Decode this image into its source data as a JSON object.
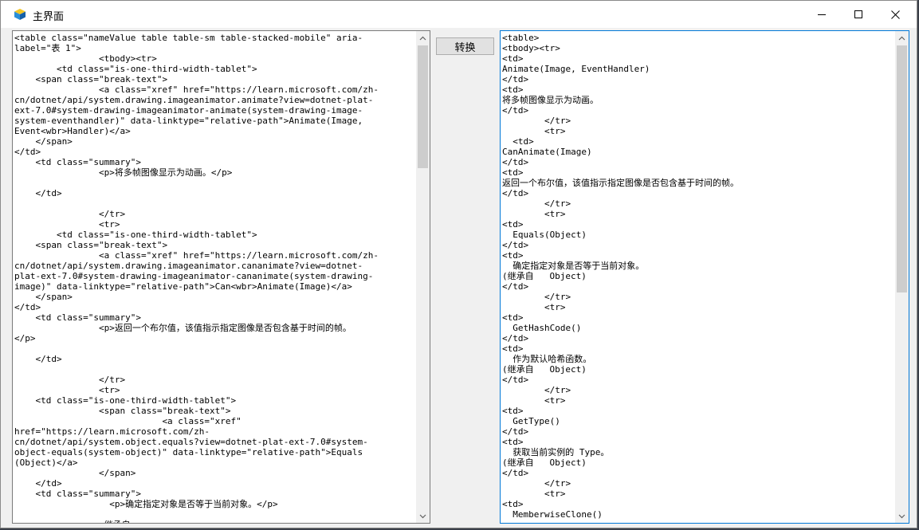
{
  "window": {
    "title": "主界面"
  },
  "toolbar": {
    "convert_label": "转换"
  },
  "left_editor": {
    "content": "<table class=\"nameValue table table-sm table-stacked-mobile\" aria-\nlabel=\"表 1\">\n\t\t\t\t<tbody><tr>\n\t\t<td class=\"is-one-third-width-tablet\">\n\t<span class=\"break-text\">\n\t\t\t\t<a class=\"xref\" href=\"https://learn.microsoft.com/zh-\ncn/dotnet/api/system.drawing.imageanimator.animate?view=dotnet-plat-\next-7.0#system-drawing-imageanimator-animate(system-drawing-image-\nsystem-eventhandler)\" data-linktype=\"relative-path\">Animate(Image,\nEvent<wbr>Handler)</a>\n\t</span>\n</td>\n\t<td class=\"summary\">\n\t\t\t\t<p>将多帧图像显示为动画。</p>\n\n\t</td>\n\n\t\t\t\t</tr>\n\t\t\t\t<tr>\n\t\t<td class=\"is-one-third-width-tablet\">\n\t<span class=\"break-text\">\n\t\t\t\t<a class=\"xref\" href=\"https://learn.microsoft.com/zh-\ncn/dotnet/api/system.drawing.imageanimator.cananimate?view=dotnet-\nplat-ext-7.0#system-drawing-imageanimator-cananimate(system-drawing-\nimage)\" data-linktype=\"relative-path\">Can<wbr>Animate(Image)</a>\n\t</span>\n</td>\n\t<td class=\"summary\">\n\t\t\t\t<p>返回一个布尔值，该值指示指定图像是否包含基于时间的帧。\n</p>\n\n\t</td>\n\n\t\t\t\t</tr>\n\t\t\t\t<tr>\n\t<td class=\"is-one-third-width-tablet\">\n\t\t\t\t<span class=\"break-text\">\n\t\t\t\t\t\t\t<a class=\"xref\"\nhref=\"https://learn.microsoft.com/zh-\ncn/dotnet/api/system.object.equals?view=dotnet-plat-ext-7.0#system-\nobject-equals(system-object)\" data-linktype=\"relative-path\">Equals\n(Object)</a>\n\t\t\t\t</span>\n\t</td>\n\t<td class=\"summary\">\n\t\t\t\t  <p>确定指定对象是否等于当前对象。</p>\n\n\t\t\t\t<继承自 >< ...>"
  },
  "right_editor": {
    "content": "<table>\n<tbody><tr>\n<td>\nAnimate(Image, EventHandler)\n</td>\n<td>\n将多帧图像显示为动画。\n</td>\n        </tr>\n        <tr>\n  <td>\nCanAnimate(Image)\n</td>\n<td>\n返回一个布尔值，该值指示指定图像是否包含基于时间的帧。\n</td>\n        </tr>\n        <tr>\n<td>\n  Equals(Object)\n</td>\n<td>\n  确定指定对象是否等于当前对象。\n(继承自   Object)\n</td>\n        </tr>\n        <tr>\n<td>\n  GetHashCode()\n</td>\n<td>\n  作为默认哈希函数。\n(继承自   Object)\n</td>\n        </tr>\n        <tr>\n<td>\n  GetType()\n</td>\n<td>\n  获取当前实例的 Type。\n(继承自   Object)\n</td>\n        </tr>\n        <tr>\n<td>\n  MemberwiseClone()"
  },
  "icons": {
    "app": "app-cube-icon",
    "minimize": "minimize-icon",
    "maximize": "maximize-icon",
    "close": "close-icon"
  },
  "colors": {
    "focus_border": "#0078d7",
    "window_bg": "#f0f0f0"
  }
}
